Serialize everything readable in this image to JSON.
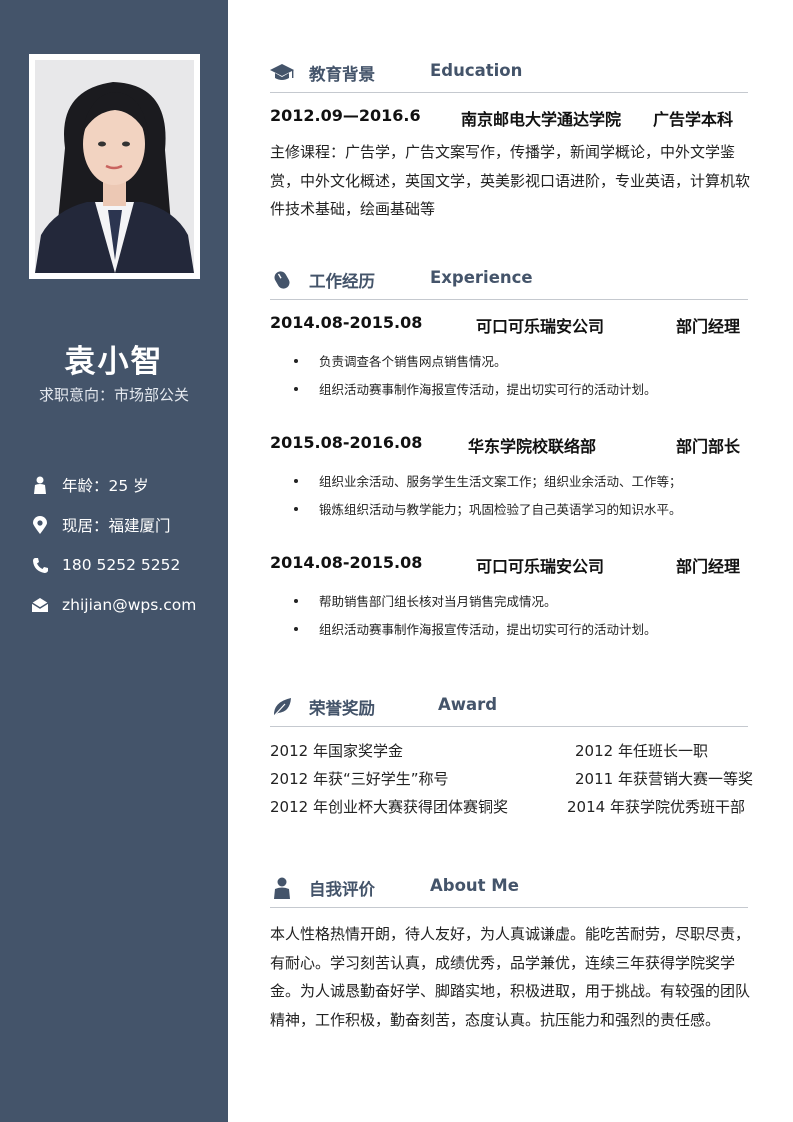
{
  "sidebar": {
    "name": "袁小智",
    "objective": "求职意向：市场部公关",
    "info": [
      {
        "icon": "person-icon",
        "text": "年龄：25 岁"
      },
      {
        "icon": "location-pin-icon",
        "text": "现居：福建厦门"
      },
      {
        "icon": "phone-icon",
        "text": "180 5252 5252"
      },
      {
        "icon": "envelope-icon",
        "text": "zhijian@wps.com"
      }
    ]
  },
  "education": {
    "title_cn": "教育背景",
    "title_en": "Education",
    "period": "2012.09—2016.6",
    "school": "南京邮电大学通达学院",
    "major": "广告学本科",
    "courses": "主修课程：广告学，广告文案写作，传播学，新闻学概论，中外文学鉴赏，中外文化概述，英国文学，英美影视口语进阶，专业英语，计算机软件技术基础，绘画基础等"
  },
  "experience": {
    "title_cn": "工作经历",
    "title_en": "Experience",
    "jobs": [
      {
        "period": "2014.08-2015.08",
        "company": "可口可乐瑞安公司",
        "role": "部门经理",
        "duties": [
          "负责调查各个销售网点销售情况。",
          "组织活动赛事制作海报宣传活动，提出切实可行的活动计划。"
        ]
      },
      {
        "period": "2015.08-2016.08",
        "company": "华东学院校联络部",
        "role": "部门部长",
        "duties": [
          "组织业余活动、服务学生生活文案工作；组织业余活动、工作等；",
          "锻炼组织活动与教学能力；巩固检验了自己英语学习的知识水平。"
        ]
      },
      {
        "period": "2014.08-2015.08",
        "company": "可口可乐瑞安公司",
        "role": "部门经理",
        "duties": [
          "帮助销售部门组长核对当月销售完成情况。",
          "组织活动赛事制作海报宣传活动，提出切实可行的活动计划。"
        ]
      }
    ]
  },
  "awards": {
    "title_cn": "荣誉奖励",
    "title_en": "Award",
    "items": [
      "2012 年国家奖学金",
      "2012 年任班长一职",
      "2012 年获“三好学生”称号",
      "2011 年获营销大赛一等奖",
      "2012 年创业杯大赛获得团体赛铜奖",
      "2014 年获学院优秀班干部"
    ]
  },
  "self_eval": {
    "title_cn": "自我评价",
    "title_en": "About Me",
    "text": "本人性格热情开朗，待人友好，为人真诚谦虚。能吃苦耐劳，尽职尽责，有耐心。学习刻苦认真，成绩优秀，品学兼优，连续三年获得学院奖学金。为人诚恳勤奋好学、脚踏实地，积极进取，用于挑战。有较强的团队精神，工作积极，勤奋刻苦，态度认真。抗压能力和强烈的责任感。"
  },
  "colors": {
    "sidebar": "#44546a",
    "heading": "#44546a",
    "rule": "#c5c9cf"
  }
}
